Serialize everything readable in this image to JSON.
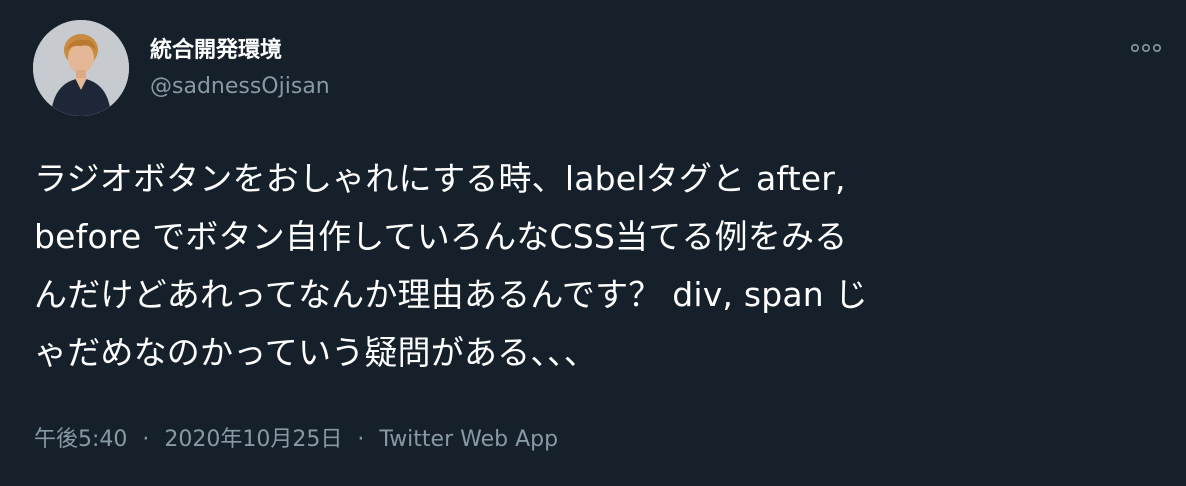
{
  "user": {
    "display_name": "統合開発環境",
    "handle": "@sadnessOjisan"
  },
  "tweet": {
    "lines": [
      "ラジオボタンをおしゃれにする時、labelタグと after,",
      "before でボタン自作していろんなCSS当てる例をみる",
      "んだけどあれってなんか理由あるんです？ div, span じ",
      "ゃだめなのかっていう疑問がある、、、"
    ]
  },
  "meta": {
    "time": "午後5:40",
    "separator": "·",
    "date": "2020年10月25日",
    "source": "Twitter Web App"
  },
  "colors": {
    "background": "#15202b",
    "text": "#ffffff",
    "secondary": "#8899a6"
  },
  "icons": {
    "more": "more-horizontal-icon",
    "avatar": "profile-photo"
  }
}
